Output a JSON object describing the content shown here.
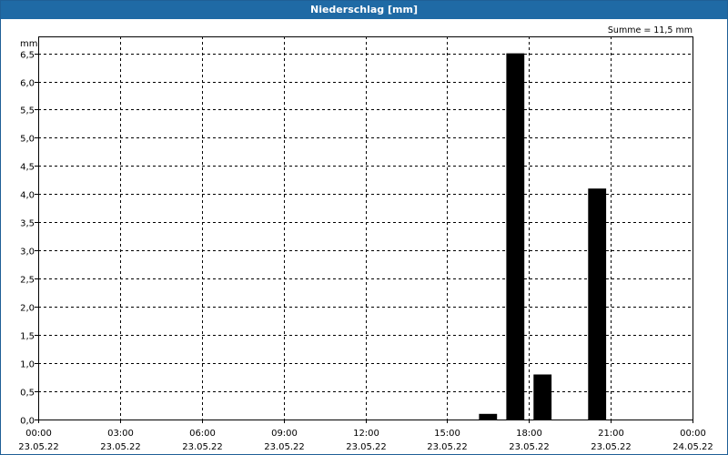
{
  "window": {
    "title": "Niederschlag [mm]"
  },
  "chart_data": {
    "type": "bar",
    "title": "Niederschlag [mm]",
    "ylabel": "mm",
    "annotation": "Summe = 11,5 mm",
    "ylim": [
      0,
      6.8
    ],
    "y_ticks": [
      0,
      0.5,
      1.0,
      1.5,
      2.0,
      2.5,
      3.0,
      3.5,
      4.0,
      4.5,
      5.0,
      5.5,
      6.0,
      6.5
    ],
    "y_tick_labels": [
      "0,0",
      "0,5",
      "1,0",
      "1,5",
      "2,0",
      "2,5",
      "3,0",
      "3,5",
      "4,0",
      "4,5",
      "5,0",
      "5,5",
      "6,0",
      "6,5"
    ],
    "x_range_hours": [
      0,
      24
    ],
    "x_ticks": [
      {
        "hour": 0,
        "time": "00:00",
        "date": "23.05.22"
      },
      {
        "hour": 3,
        "time": "03:00",
        "date": "23.05.22"
      },
      {
        "hour": 6,
        "time": "06:00",
        "date": "23.05.22"
      },
      {
        "hour": 9,
        "time": "09:00",
        "date": "23.05.22"
      },
      {
        "hour": 12,
        "time": "12:00",
        "date": "23.05.22"
      },
      {
        "hour": 15,
        "time": "15:00",
        "date": "23.05.22"
      },
      {
        "hour": 18,
        "time": "18:00",
        "date": "23.05.22"
      },
      {
        "hour": 21,
        "time": "21:00",
        "date": "23.05.22"
      },
      {
        "hour": 24,
        "time": "00:00",
        "date": "24.05.22"
      }
    ],
    "bars": [
      {
        "hour": 16.5,
        "value": 0.1
      },
      {
        "hour": 17.5,
        "value": 6.5
      },
      {
        "hour": 18.5,
        "value": 0.8
      },
      {
        "hour": 20.5,
        "value": 4.1
      }
    ],
    "grid": true,
    "bar_color": "#000000"
  }
}
